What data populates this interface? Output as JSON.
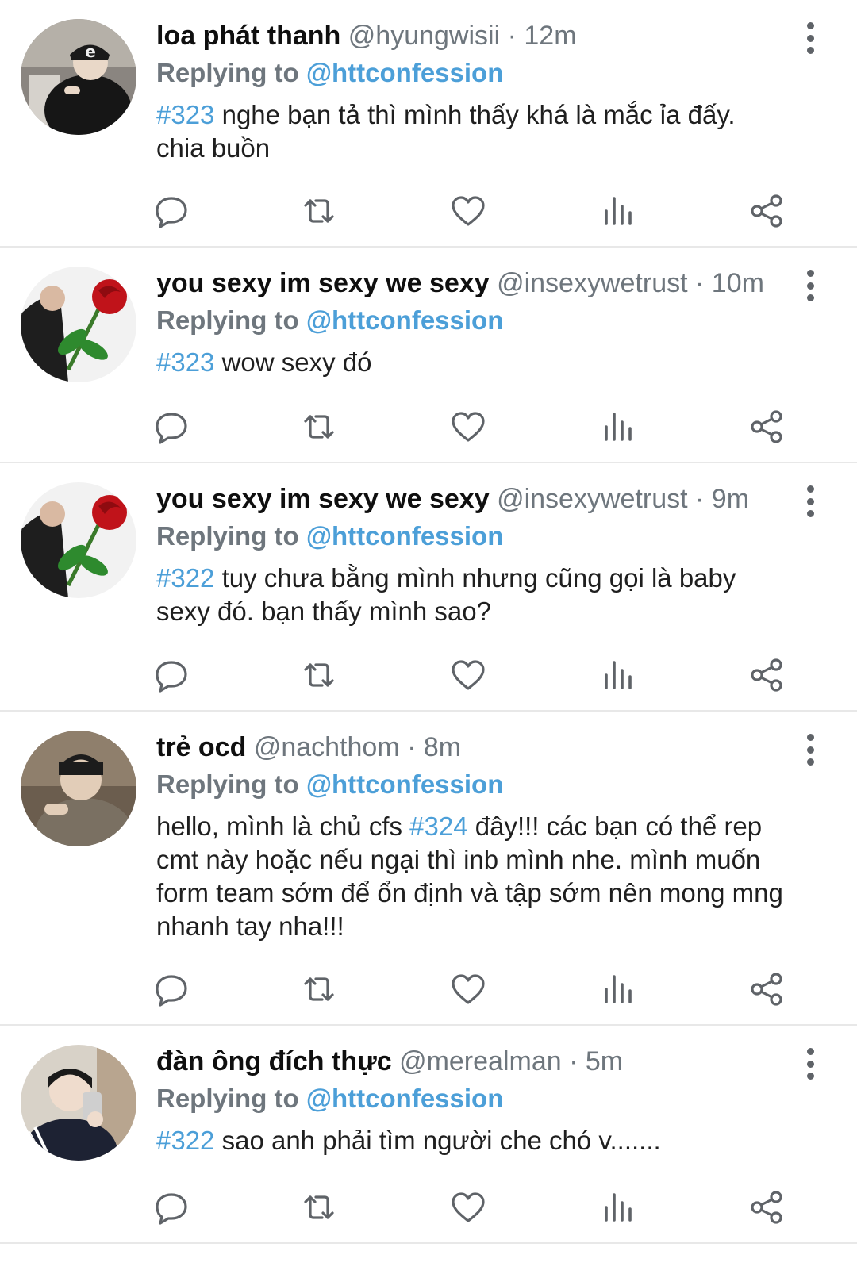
{
  "colors": {
    "accent": "#4c9fd8",
    "text": "#1f1f1f",
    "muted": "#6e767d",
    "divider": "#e8e8e8"
  },
  "tweets": [
    {
      "name": "loa phát thanh",
      "handle": "@hyungwisii",
      "sep": "·",
      "time": "12m",
      "replying_prefix": "Replying to",
      "replying_to": "@httconfession",
      "tag": "#323",
      "pre": "",
      "post": " nghe bạn tả thì mình thấy khá là mắc ỉa đấy. chia buồn",
      "avatar_icon": "avatar-person-black-jacket"
    },
    {
      "name": "you sexy im sexy we sexy",
      "handle": "@insexywetrust",
      "sep": "·",
      "time": "10m",
      "replying_prefix": "Replying to",
      "replying_to": "@httconfession",
      "tag": "#323",
      "pre": "",
      "post": " wow sexy đó",
      "avatar_icon": "avatar-rose"
    },
    {
      "name": "you sexy im sexy we sexy",
      "handle": "@insexywetrust",
      "sep": "·",
      "time": "9m",
      "replying_prefix": "Replying to",
      "replying_to": "@httconfession",
      "tag": "#322",
      "pre": "",
      "post": " tuy chưa bằng mình nhưng cũng gọi là baby sexy đó. bạn thấy mình sao?",
      "avatar_icon": "avatar-rose"
    },
    {
      "name": "trẻ ocd",
      "handle": "@nachthom",
      "sep": "·",
      "time": "8m",
      "replying_prefix": "Replying to",
      "replying_to": "@httconfession",
      "tag": "#324",
      "pre": "hello, mình là chủ cfs ",
      "post": " đây!!! các bạn có thể rep cmt này hoặc nếu ngại thì inb mình nhe. mình muốn form team sớm để ổn định và tập sớm nên mong mng nhanh tay nha!!!",
      "avatar_icon": "avatar-person-jacket"
    },
    {
      "name": "đàn ông đích thực",
      "handle": "@merealman",
      "sep": "·",
      "time": "5m",
      "replying_prefix": "Replying to",
      "replying_to": "@httconfession",
      "tag": "#322",
      "pre": "",
      "post": " sao anh phải tìm người che chó v.......",
      "avatar_icon": "avatar-person-mirror-selfie"
    }
  ]
}
